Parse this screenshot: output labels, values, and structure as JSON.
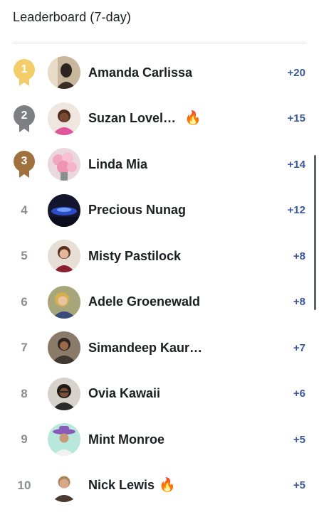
{
  "header": {
    "title": "Leaderboard (7-day)"
  },
  "colors": {
    "gold": "#f2cd6a",
    "silver": "#7d7f83",
    "bronze": "#a0713f",
    "score": "#385898"
  },
  "entries": [
    {
      "rank": "1",
      "name": "Amanda Carlissa",
      "score": "+20",
      "medal": "gold",
      "fire": false
    },
    {
      "rank": "2",
      "name": "Suzan Lovel…",
      "score": "+15",
      "medal": "silver",
      "fire": true
    },
    {
      "rank": "3",
      "name": "Linda Mia",
      "score": "+14",
      "medal": "bronze",
      "fire": false
    },
    {
      "rank": "4",
      "name": "Precious Nunag",
      "score": "+12",
      "medal": null,
      "fire": false
    },
    {
      "rank": "5",
      "name": "Misty Pastilock",
      "score": "+8",
      "medal": null,
      "fire": false
    },
    {
      "rank": "6",
      "name": "Adele Groenewald",
      "score": "+8",
      "medal": null,
      "fire": false
    },
    {
      "rank": "7",
      "name": "Simandeep Kaur…",
      "score": "+7",
      "medal": null,
      "fire": false
    },
    {
      "rank": "8",
      "name": "Ovia Kawaii",
      "score": "+6",
      "medal": null,
      "fire": false
    },
    {
      "rank": "9",
      "name": "Mint Monroe",
      "score": "+5",
      "medal": null,
      "fire": false
    },
    {
      "rank": "10",
      "name": "Nick Lewis",
      "score": "+5",
      "medal": null,
      "fire": true
    }
  ],
  "icons": {
    "fire": "🔥",
    "medal": "ribbon-medal-icon",
    "avatar": "profile-photo"
  }
}
